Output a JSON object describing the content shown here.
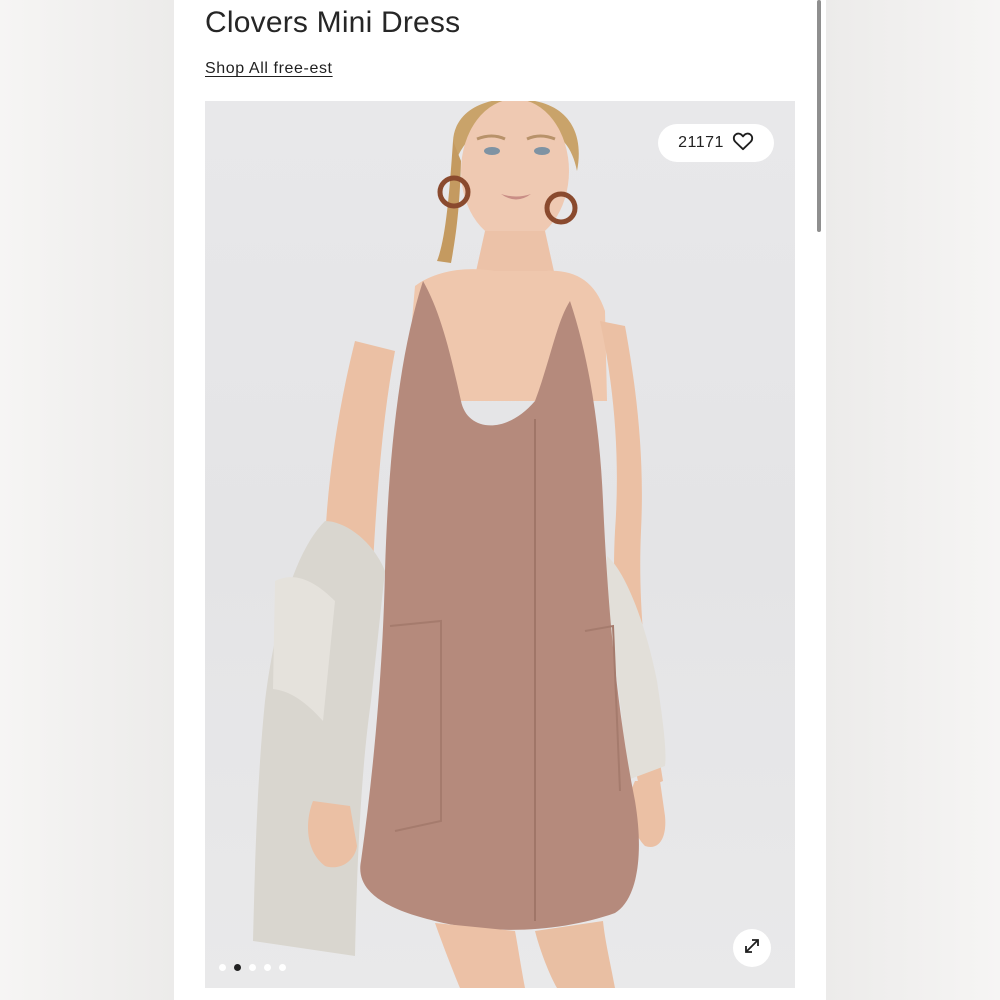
{
  "product": {
    "title": "Clovers Mini Dress",
    "shop_link": "Shop All free-est"
  },
  "gallery": {
    "like_count": "21171",
    "like_icon": "heart-outline-icon",
    "expand_icon": "expand-arrows-icon",
    "image_count": 5,
    "active_index": 1
  },
  "colors": {
    "dress": "#b58a7c",
    "background": "#e6e6e8"
  }
}
